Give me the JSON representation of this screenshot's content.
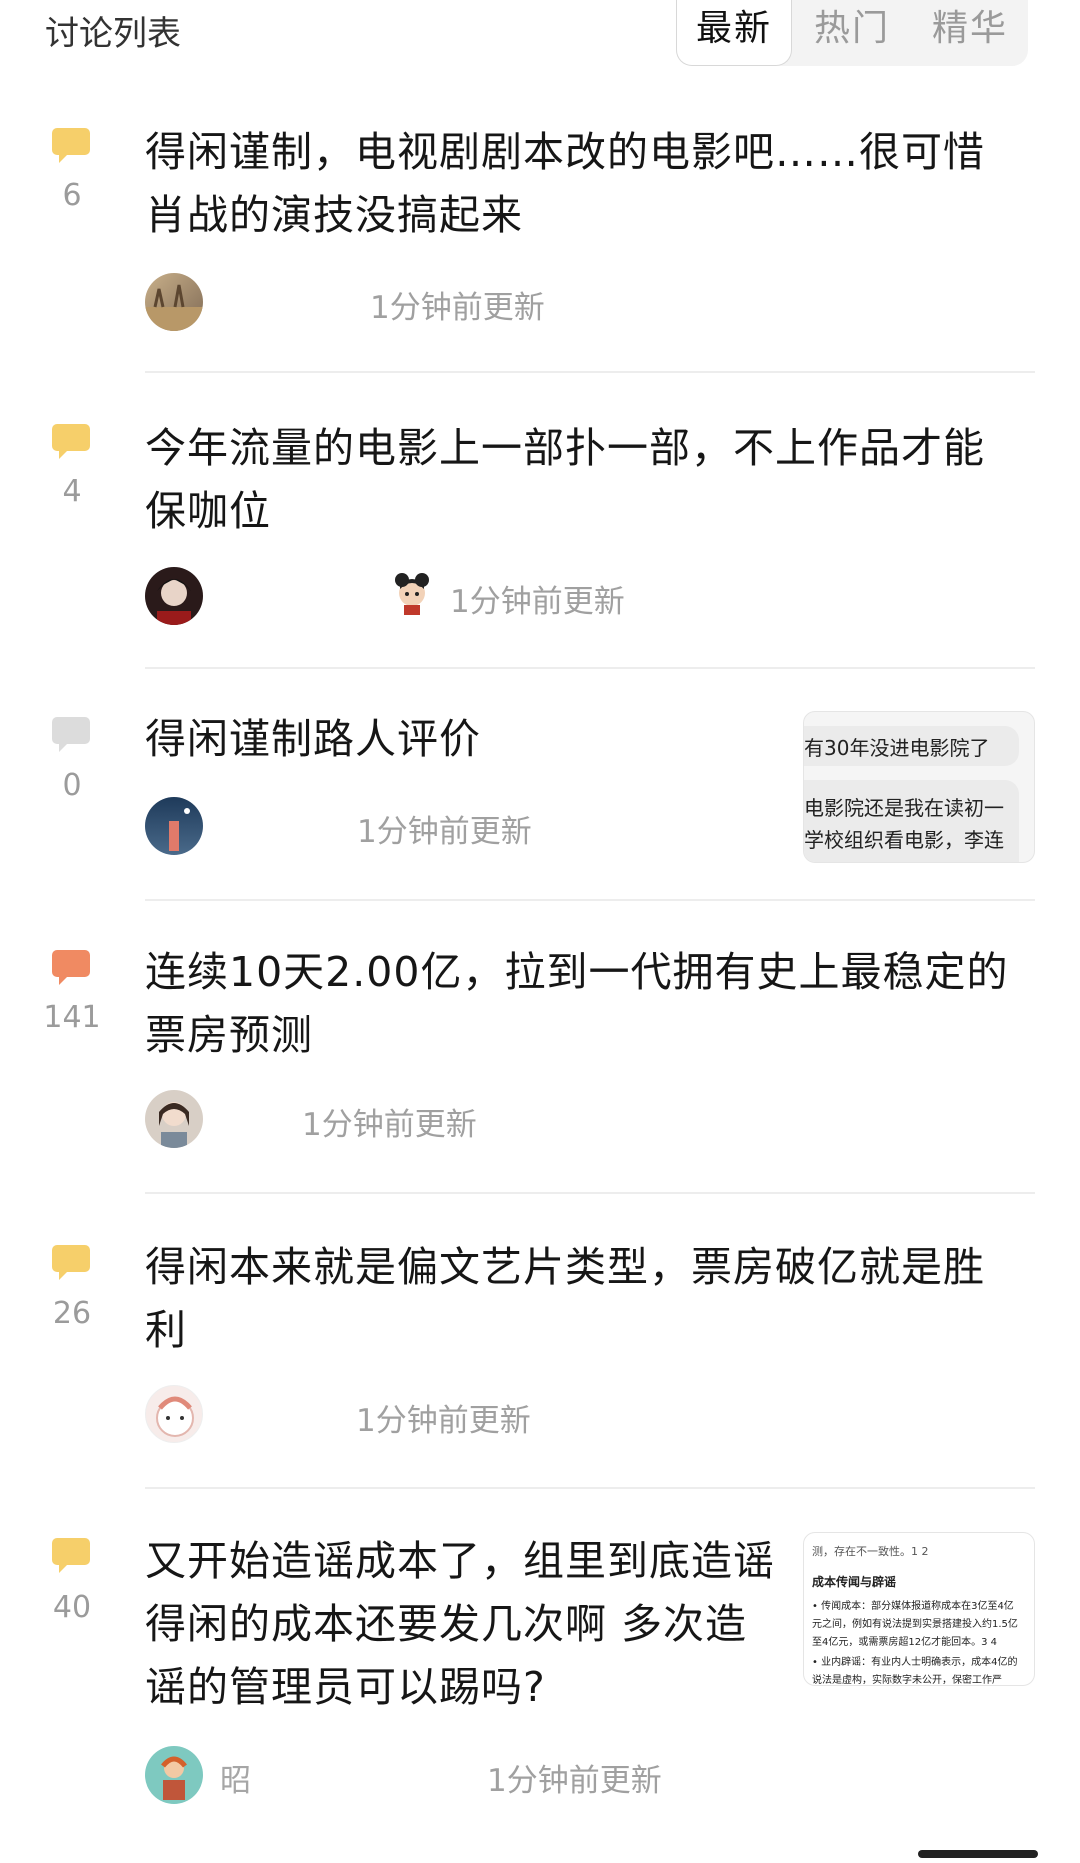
{
  "header": {
    "title": "讨论列表",
    "tabs": [
      {
        "label": "最新",
        "active": true
      },
      {
        "label": "热门",
        "active": false
      },
      {
        "label": "精华",
        "active": false
      }
    ]
  },
  "colors": {
    "bubble_yellow": "#f6cf6a",
    "bubble_gray": "#dcdcdc",
    "bubble_orange": "#f08a62"
  },
  "posts": [
    {
      "title": "得闲谨制，电视剧剧本改的电影吧……很可惜肖战的演技没搞起来",
      "count": "6",
      "icon": "comment-bubble-icon",
      "meta": "1分钟前更新"
    },
    {
      "title": "今年流量的电影上一部扑一部，不上作品才能保咖位",
      "count": "4",
      "icon": "comment-bubble-icon",
      "meta": "1分钟前更新"
    },
    {
      "title": "得闲谨制路人评价",
      "count": "0",
      "icon": "comment-bubble-icon",
      "meta": "1分钟前更新",
      "thumb_lines": [
        "有30年没进电影院了",
        "电影院还是我在读初一",
        "学校组织看电影，李连"
      ]
    },
    {
      "title": "连续10天2.00亿，拉到一代拥有史上最稳定的票房预测",
      "count": "141",
      "icon": "comment-bubble-icon",
      "meta": "1分钟前更新"
    },
    {
      "title": "得闲本来就是偏文艺片类型，票房破亿就是胜利",
      "count": "26",
      "icon": "comment-bubble-icon",
      "meta": "1分钟前更新"
    },
    {
      "title": "又开始造谣成本了，组里到底造谣得闲的成本还要发几次啊 多次造谣的管理员可以踢吗?",
      "count": "40",
      "icon": "comment-bubble-icon",
      "meta": "1分钟前更新",
      "author": "昭",
      "thumb_lines": [
        "测，存在不一致性。1 2",
        "成本传闻与辟谣",
        "• 传闻成本：部分媒体报道称成本在3亿至4亿",
        "元之间，例如有说法提到实景搭建投入约1.5亿",
        "至4亿元，或需票房超12亿才能回本。3 4",
        "• 业内辟谣：有业内人士明确表示，成本4亿的",
        "说法是虚构，实际数字未公开，保密工作严"
      ]
    }
  ]
}
